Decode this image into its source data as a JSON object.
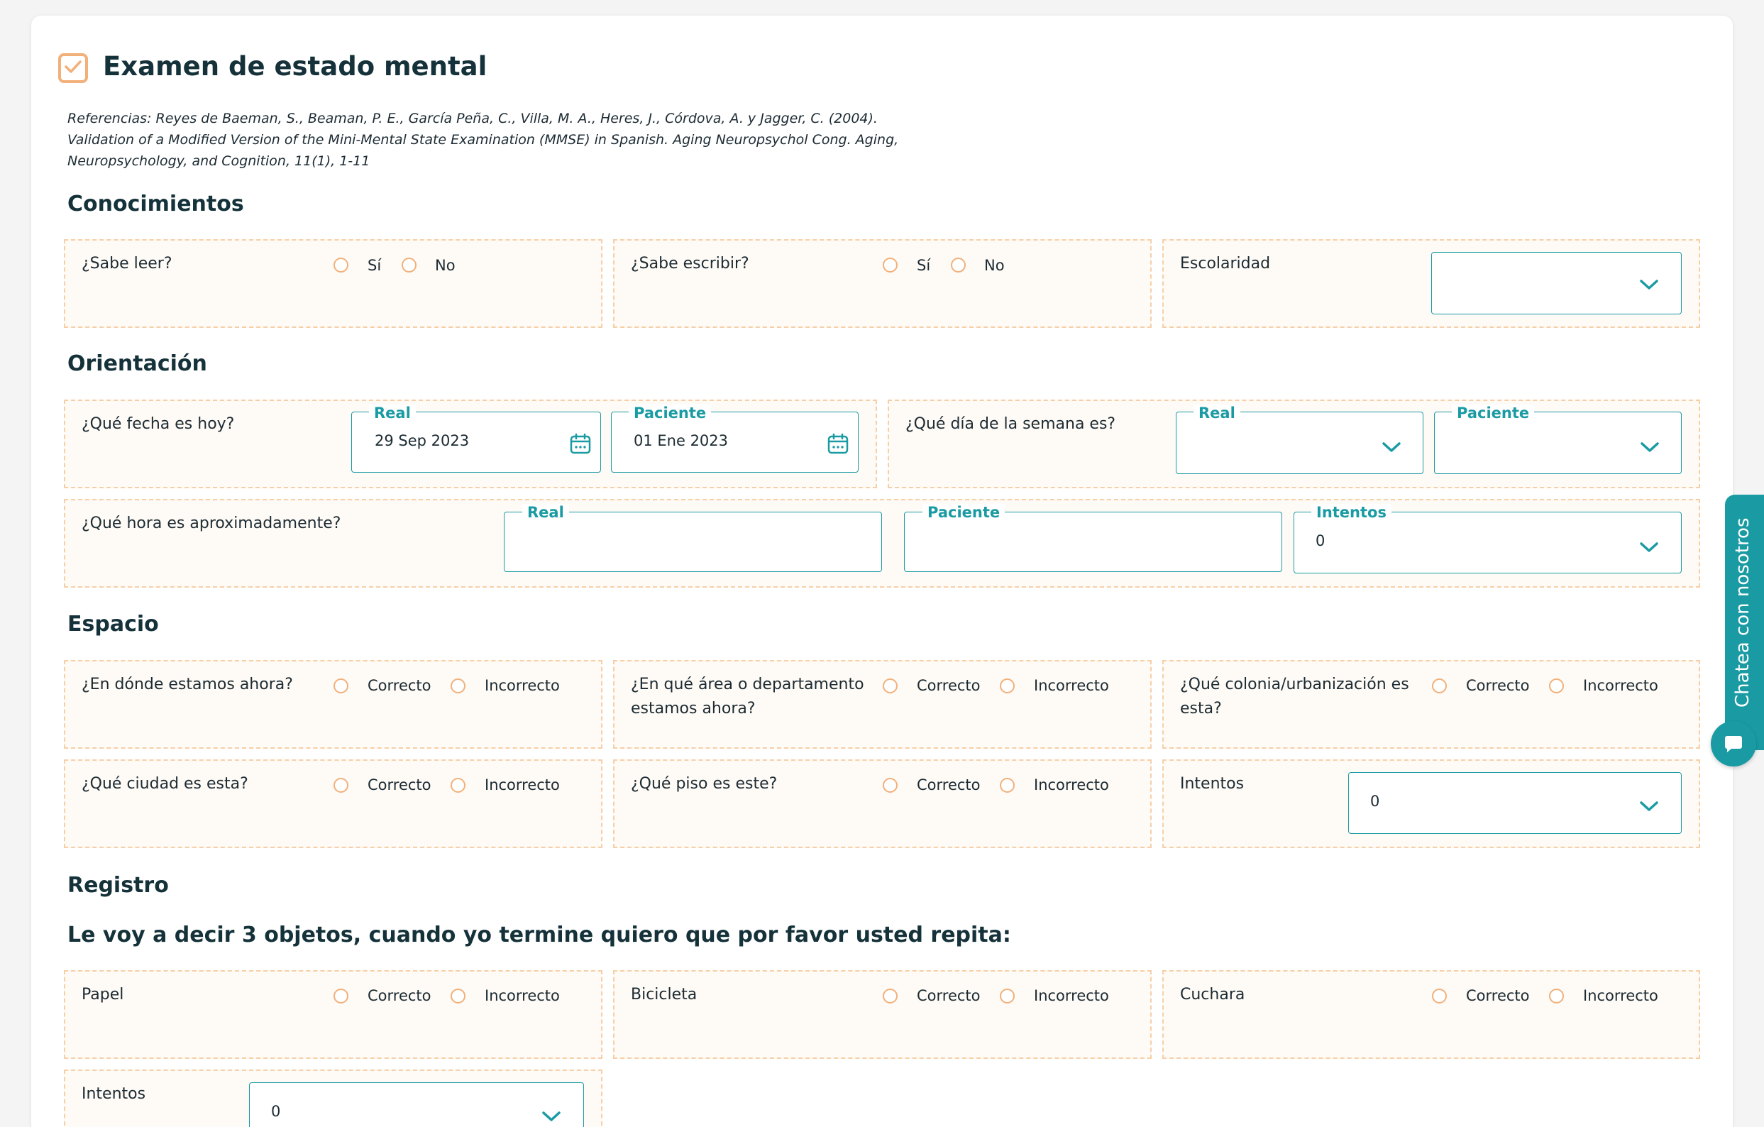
{
  "title": "Examen de estado mental",
  "references": [
    "Referencias: Reyes de Baeman, S., Beaman, P. E., García Peña, C., Villa, M. A., Heres, J., Córdova, A. y Jagger, C. (2004).",
    "Validation of a Modified Version of the Mini-Mental State Examination (MMSE) in Spanish. Aging Neuropsychol Cong. Aging,",
    "Neuropsychology, and Cognition, 11(1), 1-11"
  ],
  "sections": {
    "conocimientos": "Conocimientos",
    "orientacion": "Orientación",
    "espacio": "Espacio",
    "registro": "Registro"
  },
  "registro_instruction": "Le voy a decir 3 objetos, cuando yo termine quiero que por favor usted repita:",
  "options": {
    "si": "Sí",
    "no": "No",
    "correcto": "Correcto",
    "incorrecto": "Incorrecto"
  },
  "conocimientos": {
    "leer": "¿Sabe leer?",
    "escribir": "¿Sabe escribir?",
    "escolaridad": "Escolaridad",
    "escolaridad_value": ""
  },
  "orientacion": {
    "fecha_q": "¿Qué fecha es hoy?",
    "real_label": "Real",
    "paciente_label": "Paciente",
    "intentos_label": "Intentos",
    "fecha_real": "29 Sep 2023",
    "fecha_paciente": "01 Ene 2023",
    "dia_q": "¿Qué día de la semana es?",
    "dia_real": "",
    "dia_paciente": "",
    "hora_q": "¿Qué hora es aproximadamente?",
    "hora_real": "",
    "hora_paciente": "",
    "hora_intentos": "0"
  },
  "espacio": {
    "donde": "¿En dónde estamos ahora?",
    "area_line1": "¿En qué área o departamento",
    "area_line2": "estamos ahora?",
    "colonia_line1": "¿Qué colonia/urbanización es",
    "colonia_line2": "esta?",
    "ciudad": "¿Qué ciudad es esta?",
    "piso": "¿Qué piso es este?",
    "intentos": "Intentos",
    "intentos_value": "0"
  },
  "registro": {
    "papel": "Papel",
    "bicicleta": "Bicicleta",
    "cuchara": "Cuchara",
    "intentos": "Intentos",
    "intentos_value": "0"
  },
  "chat": {
    "label": "Chatea con nosotros"
  },
  "colors": {
    "accent": "#1a9ba3",
    "check": "#f2b07a",
    "panel_border": "#f7cfa7",
    "panel_bg": "#fefaf5"
  }
}
